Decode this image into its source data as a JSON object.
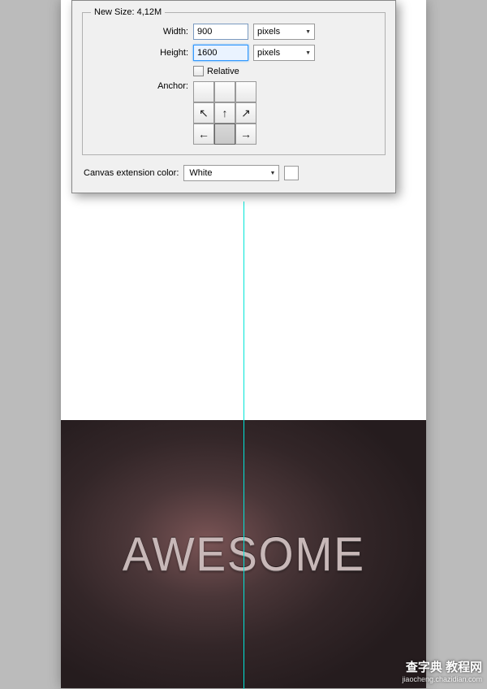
{
  "dialog": {
    "new_size_label": "New Size: 4,12M",
    "width_label": "Width:",
    "width_value": "900",
    "height_label": "Height:",
    "height_value": "1600",
    "unit": "pixels",
    "relative_label": "Relative",
    "anchor_label": "Anchor:",
    "ext_color_label": "Canvas extension color:",
    "ext_color_value": "White"
  },
  "canvas": {
    "text": "AWESOME"
  },
  "watermark": {
    "main": "查字典 教程网",
    "sub": "jiaocheng.chazidian.com"
  },
  "arrows": {
    "nw": "↖",
    "n": "↑",
    "ne": "↗",
    "w": "←",
    "e": "→",
    "sw": "",
    "s": "",
    "se": ""
  }
}
